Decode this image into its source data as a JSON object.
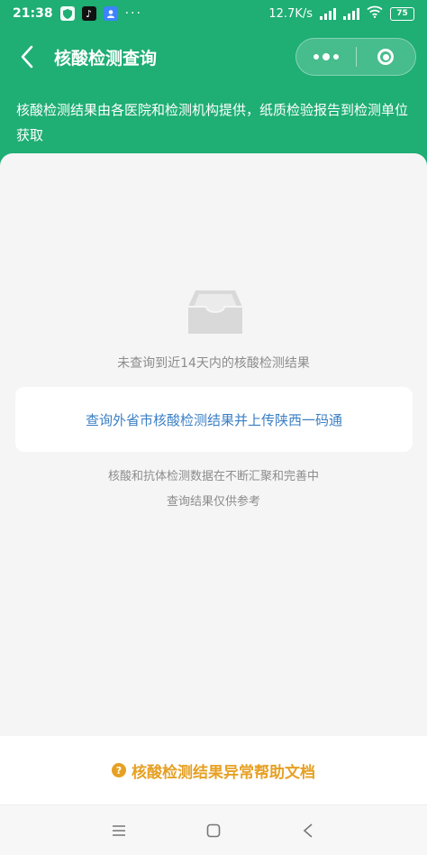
{
  "status_bar": {
    "time": "21:38",
    "dots": "···",
    "network_speed": "12.7K/s",
    "battery": "75"
  },
  "nav": {
    "title": "核酸检测查询"
  },
  "info_banner": {
    "text": "核酸检测结果由各医院和检测机构提供，纸质检验报告到检测单位获取"
  },
  "content": {
    "empty_text": "未查询到近14天内的核酸检测结果",
    "query_button_label": "查询外省市核酸检测结果并上传陕西一码通",
    "note_line1": "核酸和抗体检测数据在不断汇聚和完善中",
    "note_line2": "查询结果仅供参考"
  },
  "help": {
    "icon_glyph": "?",
    "label": "核酸检测结果异常帮助文档"
  },
  "colors": {
    "brand_green": "#1fae74",
    "link_blue": "#3b7fc4",
    "help_orange": "#e6a023"
  }
}
